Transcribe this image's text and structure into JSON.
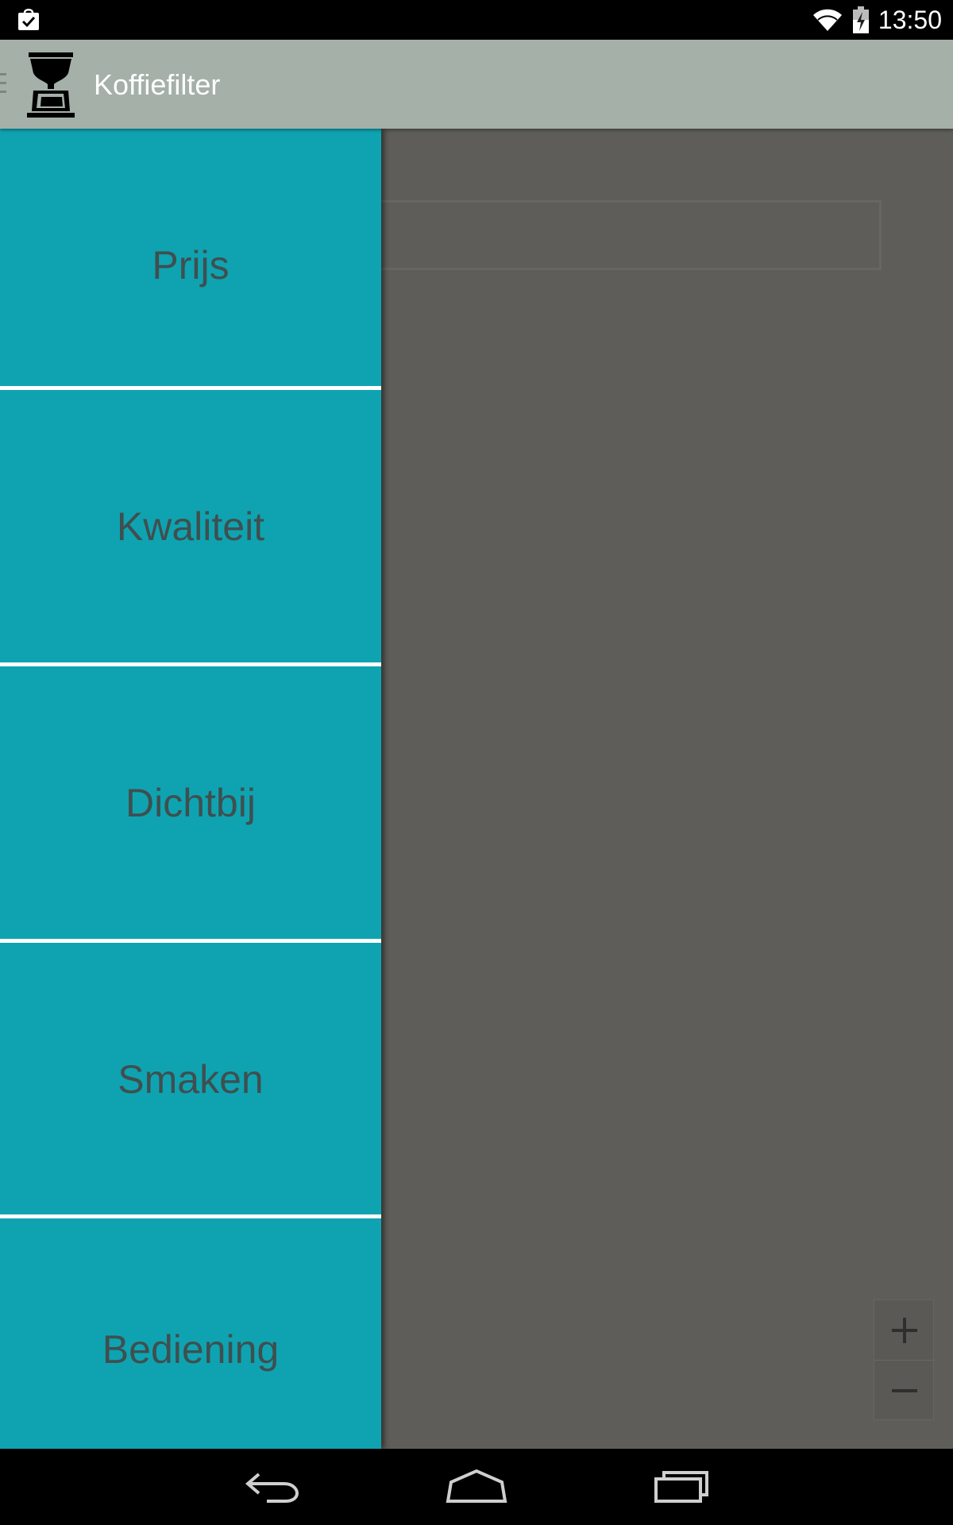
{
  "status_bar": {
    "time": "13:50",
    "left_icon": "shopping-bag-check-icon",
    "wifi_icon": "wifi-icon",
    "battery_icon": "battery-charging-icon"
  },
  "action_bar": {
    "title": "Koffiefilter",
    "logo_icon": "coffee-maker-icon",
    "background": "#a4b0a8"
  },
  "drawer": {
    "items": [
      {
        "label": "Prijs"
      },
      {
        "label": "Kwaliteit"
      },
      {
        "label": "Dichtbij"
      },
      {
        "label": "Smaken"
      },
      {
        "label": "Bediening"
      }
    ],
    "background": "#0fa3b1",
    "divider_color": "#ffffff",
    "text_color": "#3f4f4f"
  },
  "map": {
    "zoom_in_icon": "plus-icon",
    "zoom_out_icon": "minus-icon"
  },
  "nav_bar": {
    "back_icon": "back-icon",
    "home_icon": "home-icon",
    "recents_icon": "recent-apps-icon"
  }
}
